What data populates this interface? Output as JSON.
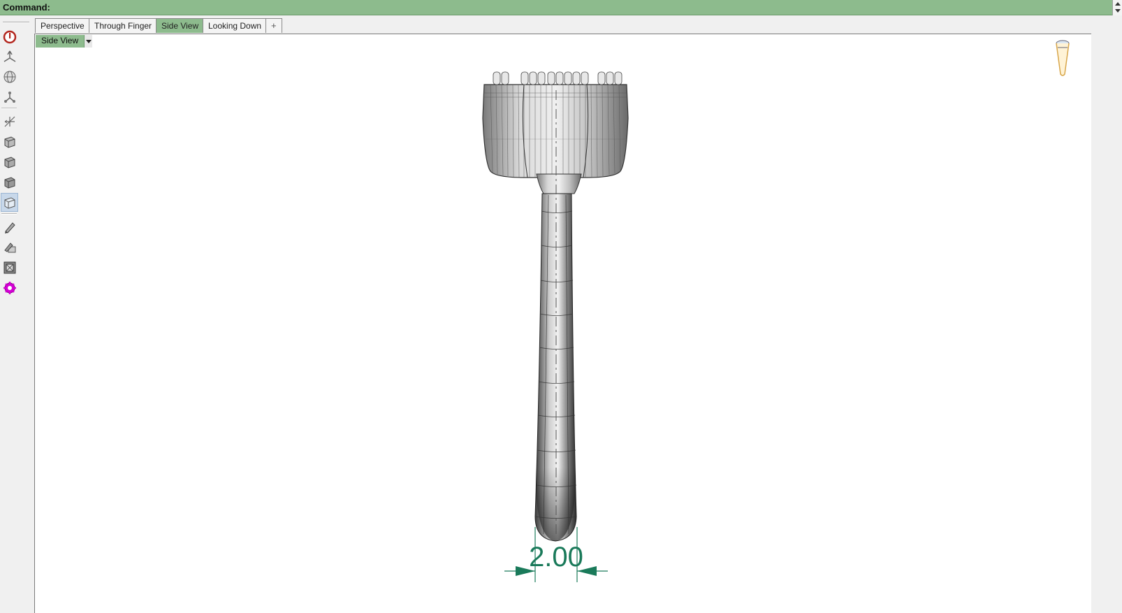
{
  "command_bar": {
    "label": "Command:"
  },
  "tabs": [
    {
      "label": "Perspective"
    },
    {
      "label": "Through Finger"
    },
    {
      "label": "Side View",
      "active": true
    },
    {
      "label": "Looking Down"
    },
    {
      "label": "+"
    }
  ],
  "viewport": {
    "title": "Side View"
  },
  "dimension": {
    "value": "2.00",
    "color": "#1a7a5a"
  },
  "tools": [
    "power-icon",
    "plane-icon",
    "globe-icon",
    "nodes-icon",
    "axis-icon",
    "box-icon",
    "box-icon",
    "box-icon",
    "box-wire-icon",
    "pen-icon",
    "pen-plane-icon",
    "frame-icon",
    "gear-icon"
  ],
  "colors": {
    "accent": "#8dbb8d",
    "viewport_bg": "#ffffff"
  }
}
